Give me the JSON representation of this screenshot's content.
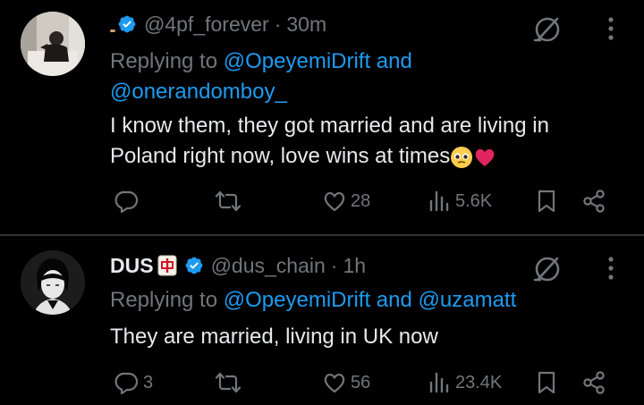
{
  "tweets": [
    {
      "name": "",
      "handle": "@4pf_forever",
      "time": "30m",
      "reply_prefix": "Replying to",
      "reply_line1_links": "@OpeyemiDrift and",
      "reply_line2_links": "@onerandomboy_",
      "text_line1": "I know them, they got married and are living in",
      "text_line2": "Poland right now, love wins at times",
      "replies": "",
      "retweets": "",
      "likes": "28",
      "views": "5.6K"
    },
    {
      "name": "DUS",
      "handle": "@dus_chain",
      "time": "1h",
      "reply_prefix": "Replying to",
      "reply_line1_links": "@OpeyemiDrift and @uzamatt",
      "text_line1": "They are married, living in UK now",
      "replies": "3",
      "retweets": "",
      "likes": "56",
      "views": "23.4K"
    }
  ],
  "separator": "·",
  "colors": {
    "background": "#000000",
    "text": "#e7e9ea",
    "muted": "#71767b",
    "link": "#1d9bf0",
    "verified": "#1d9bf0",
    "heart": "#e0245e"
  }
}
